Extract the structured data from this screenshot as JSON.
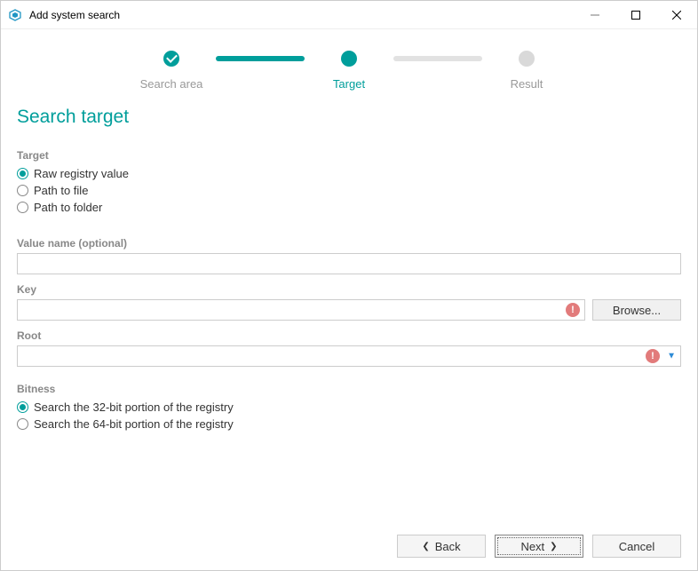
{
  "window": {
    "title": "Add system search"
  },
  "stepper": {
    "steps": [
      {
        "label": "Search area",
        "state": "done"
      },
      {
        "label": "Target",
        "state": "active"
      },
      {
        "label": "Result",
        "state": "future"
      }
    ]
  },
  "heading": "Search target",
  "target_section": {
    "label": "Target",
    "options": [
      {
        "label": "Raw registry value",
        "selected": true
      },
      {
        "label": "Path to file",
        "selected": false
      },
      {
        "label": "Path to folder",
        "selected": false
      }
    ]
  },
  "value_name": {
    "label": "Value name (optional)",
    "value": ""
  },
  "key": {
    "label": "Key",
    "value": "",
    "browse": "Browse...",
    "error": true
  },
  "root": {
    "label": "Root",
    "value": "",
    "error": true
  },
  "bitness": {
    "label": "Bitness",
    "options": [
      {
        "label": "Search the 32-bit portion of the registry",
        "selected": true
      },
      {
        "label": "Search the 64-bit portion of the registry",
        "selected": false
      }
    ]
  },
  "footer": {
    "back": "Back",
    "next": "Next",
    "cancel": "Cancel"
  }
}
